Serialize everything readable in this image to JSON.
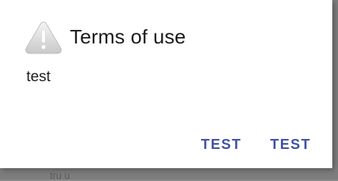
{
  "background": {
    "partial_text": "tru u"
  },
  "dialog": {
    "icon": "warning-triangle-icon",
    "title": "Terms of use",
    "message": "test",
    "buttons": [
      {
        "label": "TEST"
      },
      {
        "label": "TEST"
      }
    ]
  },
  "colors": {
    "button_text": "#3f51a5",
    "dialog_bg": "#ffffff",
    "scrim": "#7d7d7d"
  }
}
